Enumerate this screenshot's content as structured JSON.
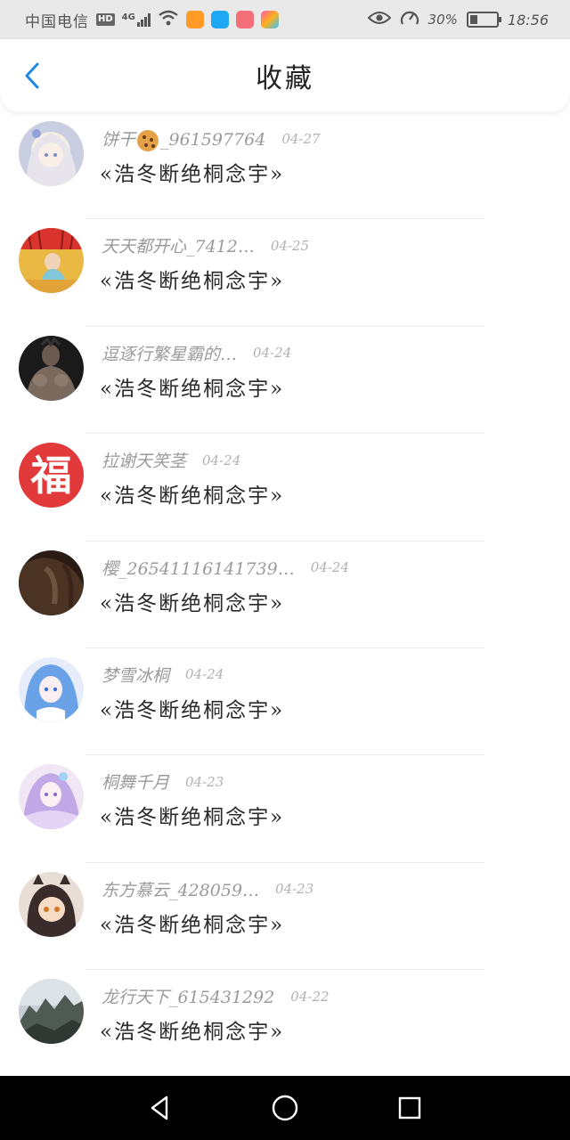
{
  "status_bar": {
    "carrier": "中国电信",
    "hd_label": "HD",
    "network_label": "4G",
    "battery_percent_text": "30%",
    "battery_level": 0.3,
    "time": "18:56",
    "icons": [
      "hd-icon",
      "signal-icon",
      "wifi-icon",
      "video-app-icon",
      "search-app-icon",
      "gift-app-icon",
      "store-app-icon",
      "eye-icon",
      "speed-icon",
      "battery-icon"
    ]
  },
  "header": {
    "title": "收藏",
    "back_icon": "chevron-left-icon",
    "accent_color": "#1e88e5"
  },
  "favorites": [
    {
      "user": "饼干",
      "user_suffix": "_961597764",
      "has_cookie_emoji": true,
      "date": "04-27",
      "title": "«浩冬断绝桐念宇»",
      "avatar_theme": "white-haired-anime-girl"
    },
    {
      "user": "天天都开心_7412…",
      "date": "04-25",
      "title": "«浩冬断绝桐念宇»",
      "avatar_theme": "girl-in-red-tassels"
    },
    {
      "user": "逗逐行繁星霸的…",
      "date": "04-24",
      "title": "«浩冬断绝桐念宇»",
      "avatar_theme": "muscular-man"
    },
    {
      "user": "拉谢天笑茎",
      "date": "04-24",
      "title": "«浩冬断绝桐念宇»",
      "avatar_theme": "fu-character",
      "avatar_text": "福"
    },
    {
      "user": "樱_26541116141739…",
      "date": "04-24",
      "title": "«浩冬断绝桐念宇»",
      "avatar_theme": "dark-hair-photo"
    },
    {
      "user": "梦雪冰桐",
      "date": "04-24",
      "title": "«浩冬断绝桐念宇»",
      "avatar_theme": "blue-hair-anime"
    },
    {
      "user": "桐舞千月",
      "date": "04-23",
      "title": "«浩冬断绝桐念宇»",
      "avatar_theme": "lavender-anime"
    },
    {
      "user": "东方慕云_428059…",
      "date": "04-23",
      "title": "«浩冬断绝桐念宇»",
      "avatar_theme": "chibi-cat-ears"
    },
    {
      "user": "龙行天下_615431292",
      "date": "04-22",
      "title": "«浩冬断绝桐念宇»",
      "avatar_theme": "mountain-landscape"
    }
  ],
  "nav_bar": {
    "back_icon": "triangle-back-icon",
    "home_icon": "circle-home-icon",
    "recents_icon": "square-recents-icon"
  }
}
